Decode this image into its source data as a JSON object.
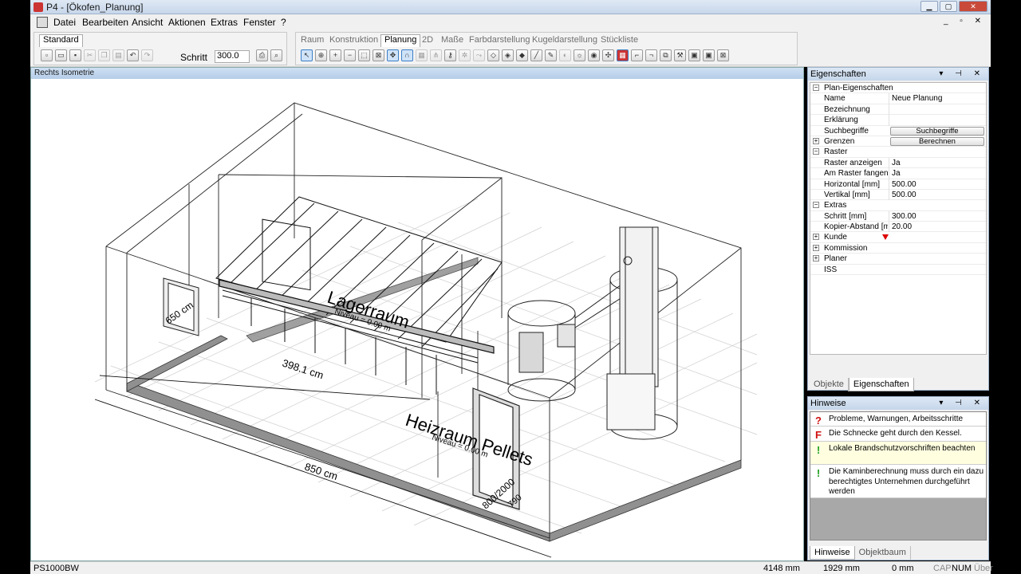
{
  "window": {
    "title": "P4 - [Ökofen_Planung]"
  },
  "menu": [
    "Datei",
    "Bearbeiten",
    "Ansicht",
    "Aktionen",
    "Extras",
    "Fenster",
    "?"
  ],
  "toolbar": {
    "standard_tab": "Standard",
    "tabs": [
      "Raum",
      "Konstruktion",
      "Planung",
      "2D",
      "Maße",
      "Farbdarstellung",
      "Kugeldarstellung",
      "Stückliste"
    ],
    "active_tab": "Planung",
    "schritt_label": "Schritt",
    "schritt_value": "300.0"
  },
  "viewport": {
    "title": "Rechts Isometrie",
    "labels": {
      "lagerraum": "Lagerraum",
      "lagerraum_niveau": "Niveau = 0.00 m",
      "heizraum": "Heizraum Pellets",
      "heizraum_niveau": "Niveau = 0.00 m",
      "dim1": "398.1 cm",
      "dim2": "850 cm",
      "dim3": "650 cm",
      "door": "800/2000",
      "door2": "790"
    }
  },
  "properties": {
    "title": "Eigenschaften",
    "rows": [
      {
        "type": "group",
        "exp": "−",
        "name": "Plan-Eigenschaften"
      },
      {
        "type": "prop",
        "name": "Name",
        "value": "Neue Planung"
      },
      {
        "type": "prop",
        "name": "Bezeichnung",
        "value": ""
      },
      {
        "type": "prop",
        "name": "Erklärung",
        "value": ""
      },
      {
        "type": "button",
        "name": "Suchbegriffe",
        "value": "Suchbegriffe"
      },
      {
        "type": "button",
        "exp": "+",
        "name": "Grenzen",
        "value": "Berechnen"
      },
      {
        "type": "group",
        "exp": "−",
        "name": "Raster"
      },
      {
        "type": "prop",
        "name": "Raster anzeigen",
        "value": "Ja"
      },
      {
        "type": "prop",
        "name": "Am Raster fangen",
        "value": "Ja"
      },
      {
        "type": "prop",
        "name": "Horizontal [mm]",
        "value": "500.00"
      },
      {
        "type": "prop",
        "name": "Vertikal [mm]",
        "value": "500.00"
      },
      {
        "type": "group",
        "exp": "−",
        "name": "Extras"
      },
      {
        "type": "prop",
        "name": "Schritt [mm]",
        "value": "300.00"
      },
      {
        "type": "prop",
        "name": "Kopier-Abstand [mm]",
        "value": "20.00"
      },
      {
        "type": "marker",
        "exp": "+",
        "name": "Kunde",
        "value": ""
      },
      {
        "type": "group",
        "exp": "+",
        "name": "Kommission"
      },
      {
        "type": "group",
        "exp": "+",
        "name": "Planer"
      },
      {
        "type": "group",
        "name": "ISS"
      }
    ],
    "bottom_tabs": [
      "Objekte",
      "Eigenschaften"
    ],
    "active_bottom_tab": "Eigenschaften"
  },
  "hints": {
    "title": "Hinweise",
    "items": [
      {
        "icon": "?",
        "color": "#d01010",
        "text": "Probleme, Warnungen, Arbeitsschritte",
        "bg": "#ffffff"
      },
      {
        "icon": "F",
        "color": "#d01010",
        "text": "Die Schnecke geht durch den Kessel.",
        "bg": "#ffffff"
      },
      {
        "icon": "!",
        "color": "#20a020",
        "text": "Lokale Brandschutzvorschriften beachten",
        "bg": "#ffffe0"
      },
      {
        "icon": "!",
        "color": "#20a020",
        "text": "Die Kaminberechnung muss durch ein dazu berechtigtes Unternehmen durchgeführt werden",
        "bg": "#ffffff"
      }
    ],
    "bottom_tabs": [
      "Hinweise",
      "Objektbaum"
    ],
    "active_bottom_tab": "Hinweise"
  },
  "status": {
    "left": "PS1000BW",
    "x": "4148 mm",
    "y": "1929 mm",
    "z": "0 mm",
    "cap": "CAP",
    "num": "NUM",
    "ovr": "Über"
  },
  "colors": {
    "wall": "#909090",
    "line": "#222222",
    "grid": "#c8c8c8",
    "panel_header": "#c5d6ea"
  }
}
